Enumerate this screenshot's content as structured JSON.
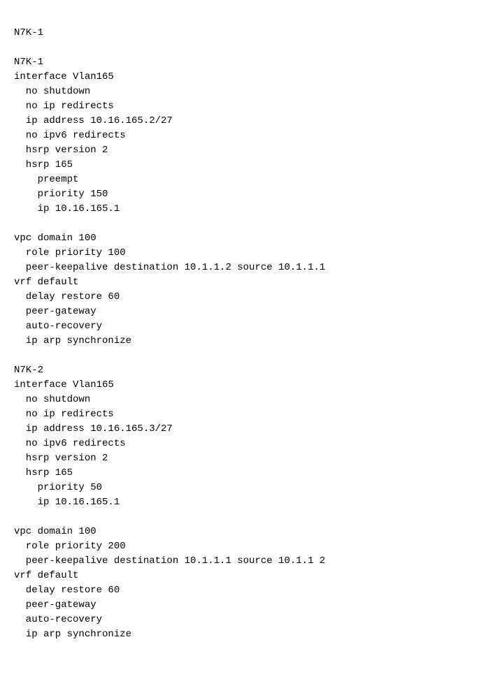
{
  "content": {
    "n7k1": {
      "header": "N7K-1",
      "interface_header": "interface Vlan165",
      "lines": [
        "  no shutdown",
        "  no ip redirects",
        "  ip address 10.16.165.2/27",
        "  no ipv6 redirects",
        "  hsrp version 2",
        "  hsrp 165",
        "    preempt",
        "    priority 150",
        "    ip 10.16.165.1"
      ],
      "blank1": "",
      "vpc_header": "vpc domain 100",
      "vpc_lines": [
        "  role priority 100",
        "  peer-keepalive destination 10.1.1.2 source 10.1.1.1"
      ],
      "vrf_header": "vrf default",
      "vrf_lines": [
        "  delay restore 60",
        "  peer-gateway",
        "  auto-recovery",
        "  ip arp synchronize"
      ]
    },
    "n7k2": {
      "header": "N7K-2",
      "interface_header": "interface Vlan165",
      "lines": [
        "  no shutdown",
        "  no ip redirects",
        "  ip address 10.16.165.3/27",
        "  no ipv6 redirects",
        "  hsrp version 2",
        "  hsrp 165",
        "    priority 50",
        "    ip 10.16.165.1"
      ],
      "blank1": "",
      "vpc_header": "vpc domain 100",
      "vpc_lines": [
        "  role priority 200",
        "  peer-keepalive destination 10.1.1.1 source 10.1.1 2"
      ],
      "vrf_header": "vrf default",
      "vrf_lines": [
        "  delay restore 60",
        "  peer-gateway",
        "  auto-recovery",
        "  ip arp synchronize"
      ]
    }
  }
}
